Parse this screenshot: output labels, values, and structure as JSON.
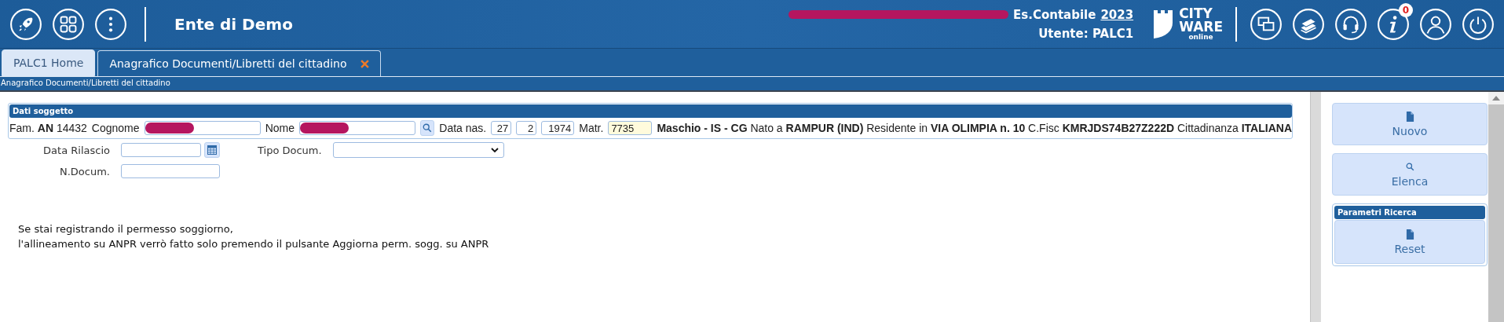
{
  "header": {
    "title": "Ente di Demo",
    "fiscal_year_label": "Es.Contabile",
    "fiscal_year": "2023",
    "user": "Utente: PALC1",
    "logo": [
      "CITY",
      "WARE",
      "online"
    ],
    "notification_count": "0"
  },
  "tabs": [
    {
      "label": "PALC1 Home",
      "selected": false,
      "closable": false
    },
    {
      "label": "Anagrafico Documenti/Libretti del cittadino",
      "selected": true,
      "closable": true
    }
  ],
  "breadcrumb": "Anagrafico Documenti/Libretti del cittadino",
  "subject": {
    "title": "Dati soggetto",
    "items": [
      {
        "kind": "summary",
        "text": "Fam. **AN** 14432"
      },
      {
        "kind": "text",
        "text": "Cognome"
      },
      {
        "kind": "redacted-input"
      },
      {
        "kind": "text",
        "text": "Nome"
      },
      {
        "kind": "redacted-input"
      },
      {
        "kind": "search"
      },
      {
        "kind": "text",
        "text": "Data nas."
      },
      {
        "kind": "input",
        "value": "27",
        "highlighted": false
      },
      {
        "kind": "input",
        "value": "2",
        "highlighted": false
      },
      {
        "kind": "input",
        "value": "1974",
        "highlighted": false
      },
      {
        "kind": "text",
        "text": "Matr."
      },
      {
        "kind": "input",
        "value": "7735",
        "highlighted": true
      },
      {
        "kind": "summary",
        "text": "**Maschio - IS - CG** Nato a **RAMPUR (IND)** Residente in **VIA OLIMPIA n. 10** C.Fisc **KMRJDS74B27Z222D** Cittadinanza **ITALIANA**"
      }
    ]
  },
  "document_rows": [
    [
      {
        "label": "Data Rilascio",
        "kind": "date"
      },
      {
        "label": "Tipo Docum.",
        "kind": "select"
      }
    ],
    [
      {
        "label": "N.Docum.",
        "kind": "text"
      }
    ]
  ],
  "notice": [
    "Se stai registrando il permesso soggiorno,",
    "l'allineamento su ANPR verrò fatto solo premendo il pulsante Aggiorna perm. sogg. su ANPR"
  ],
  "actions": [
    {
      "label": "Nuovo",
      "kind": "document"
    },
    {
      "label": "Elenca",
      "kind": "search"
    }
  ],
  "search_params": {
    "title": "Parametri Ricerca",
    "actions": [
      {
        "label": "Reset",
        "kind": "document"
      }
    ]
  }
}
